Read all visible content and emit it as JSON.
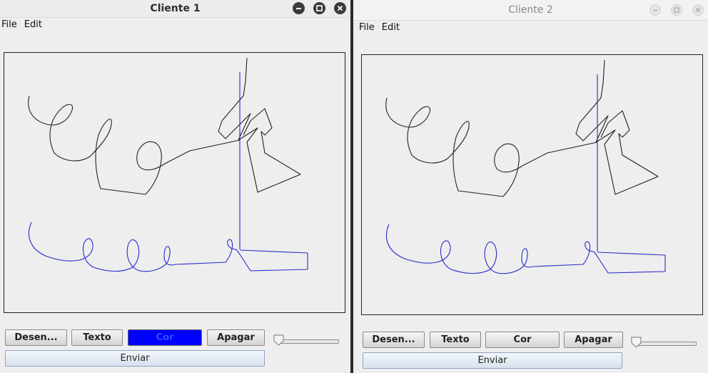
{
  "window1": {
    "title": "Cliente 1",
    "menu": [
      "File",
      "Edit"
    ],
    "buttons": {
      "draw": "Desen...",
      "text": "Texto",
      "color": "Cor",
      "erase": "Apagar",
      "send": "Enviar"
    },
    "selected_color": "#0000ff",
    "window_controls": [
      "minimize-icon",
      "maximize-icon",
      "close-icon"
    ]
  },
  "window2": {
    "title": "Cliente 2",
    "menu": [
      "File",
      "Edit"
    ],
    "buttons": {
      "draw": "Desen...",
      "text": "Texto",
      "color": "Cor",
      "erase": "Apagar",
      "send": "Enviar"
    },
    "window_controls": [
      "minimize-icon",
      "maximize-icon",
      "close-icon"
    ]
  },
  "colors": {
    "ink_black": "#222222",
    "ink_blue": "#2a2acc",
    "canvas_bg": "#eeeeee"
  }
}
